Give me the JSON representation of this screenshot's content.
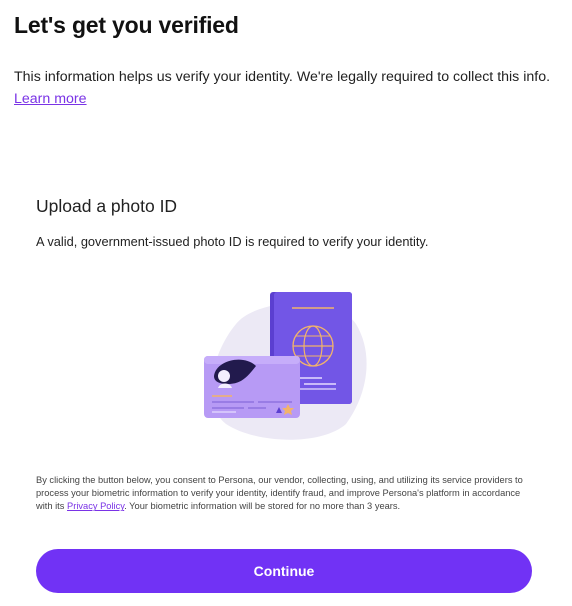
{
  "header": {
    "title": "Let's get you verified",
    "intro_text": "This information helps us verify your identity. We're legally required to collect this info.",
    "learn_more_link": "Learn more"
  },
  "upload_section": {
    "title": "Upload a photo ID",
    "description": "A valid, government-issued photo ID is required to verify your identity."
  },
  "illustration": {
    "icon": "id-documents-illustration",
    "colors": {
      "passport": "#6f4fd8",
      "card": "#b79af5",
      "blob": "#ece9f5",
      "accent": "#f2b36a"
    }
  },
  "consent": {
    "text_before_link": "By clicking the button below, you consent to Persona, our vendor, collecting, using, and utilizing its service providers to process your biometric information to verify your identity, identify fraud, and improve Persona's platform in accordance with its",
    "privacy_link": "Privacy Policy",
    "text_after_link": ". Your biometric information will be stored for no more than 3 years."
  },
  "actions": {
    "continue_label": "Continue"
  },
  "theme": {
    "accent": "#7132f5",
    "link": "#7a33e6"
  }
}
